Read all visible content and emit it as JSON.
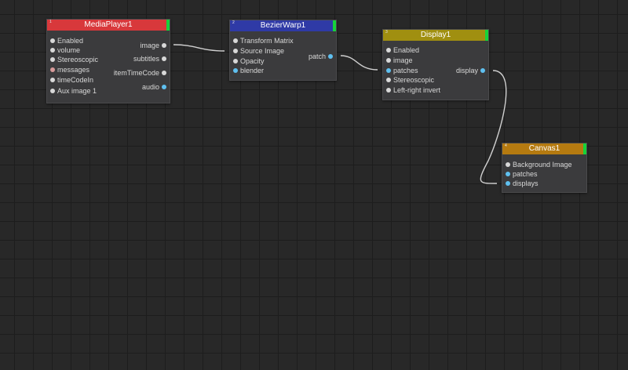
{
  "colors": {
    "background": "#282828",
    "grid": "#1d1d1d",
    "node_body": "#3b3b3d",
    "wire": "#d0d0d0",
    "port_default": "#d8d8d8",
    "port_blue": "#5fc0f0",
    "port_pink": "#d89a9a",
    "status_green": "#16d33a"
  },
  "nodes": {
    "media_player": {
      "title": "MediaPlayer1",
      "index": "1",
      "header_color": "#d8383b",
      "inputs": [
        "Enabled",
        "volume",
        "Stereoscopic",
        "messages",
        "timeCodeIn",
        "Aux image 1"
      ],
      "outputs": [
        "image",
        "subtitles",
        "itemTimeCode",
        "audio"
      ]
    },
    "bezier_warp": {
      "title": "BezierWarp1",
      "index": "2",
      "header_color": "#2f3aa6",
      "inputs": [
        "Transform Matrix",
        "Source Image",
        "Opacity",
        "blender"
      ],
      "outputs": [
        "patch"
      ]
    },
    "display": {
      "title": "Display1",
      "index": "3",
      "header_color": "#a08f10",
      "inputs": [
        "Enabled",
        "image",
        "patches",
        "Stereoscopic",
        "Left-right invert"
      ],
      "outputs": [
        "display"
      ]
    },
    "canvas": {
      "title": "Canvas1",
      "index": "4",
      "header_color": "#b57a10",
      "inputs": [
        "Background Image",
        "patches",
        "displays"
      ],
      "outputs": []
    }
  }
}
